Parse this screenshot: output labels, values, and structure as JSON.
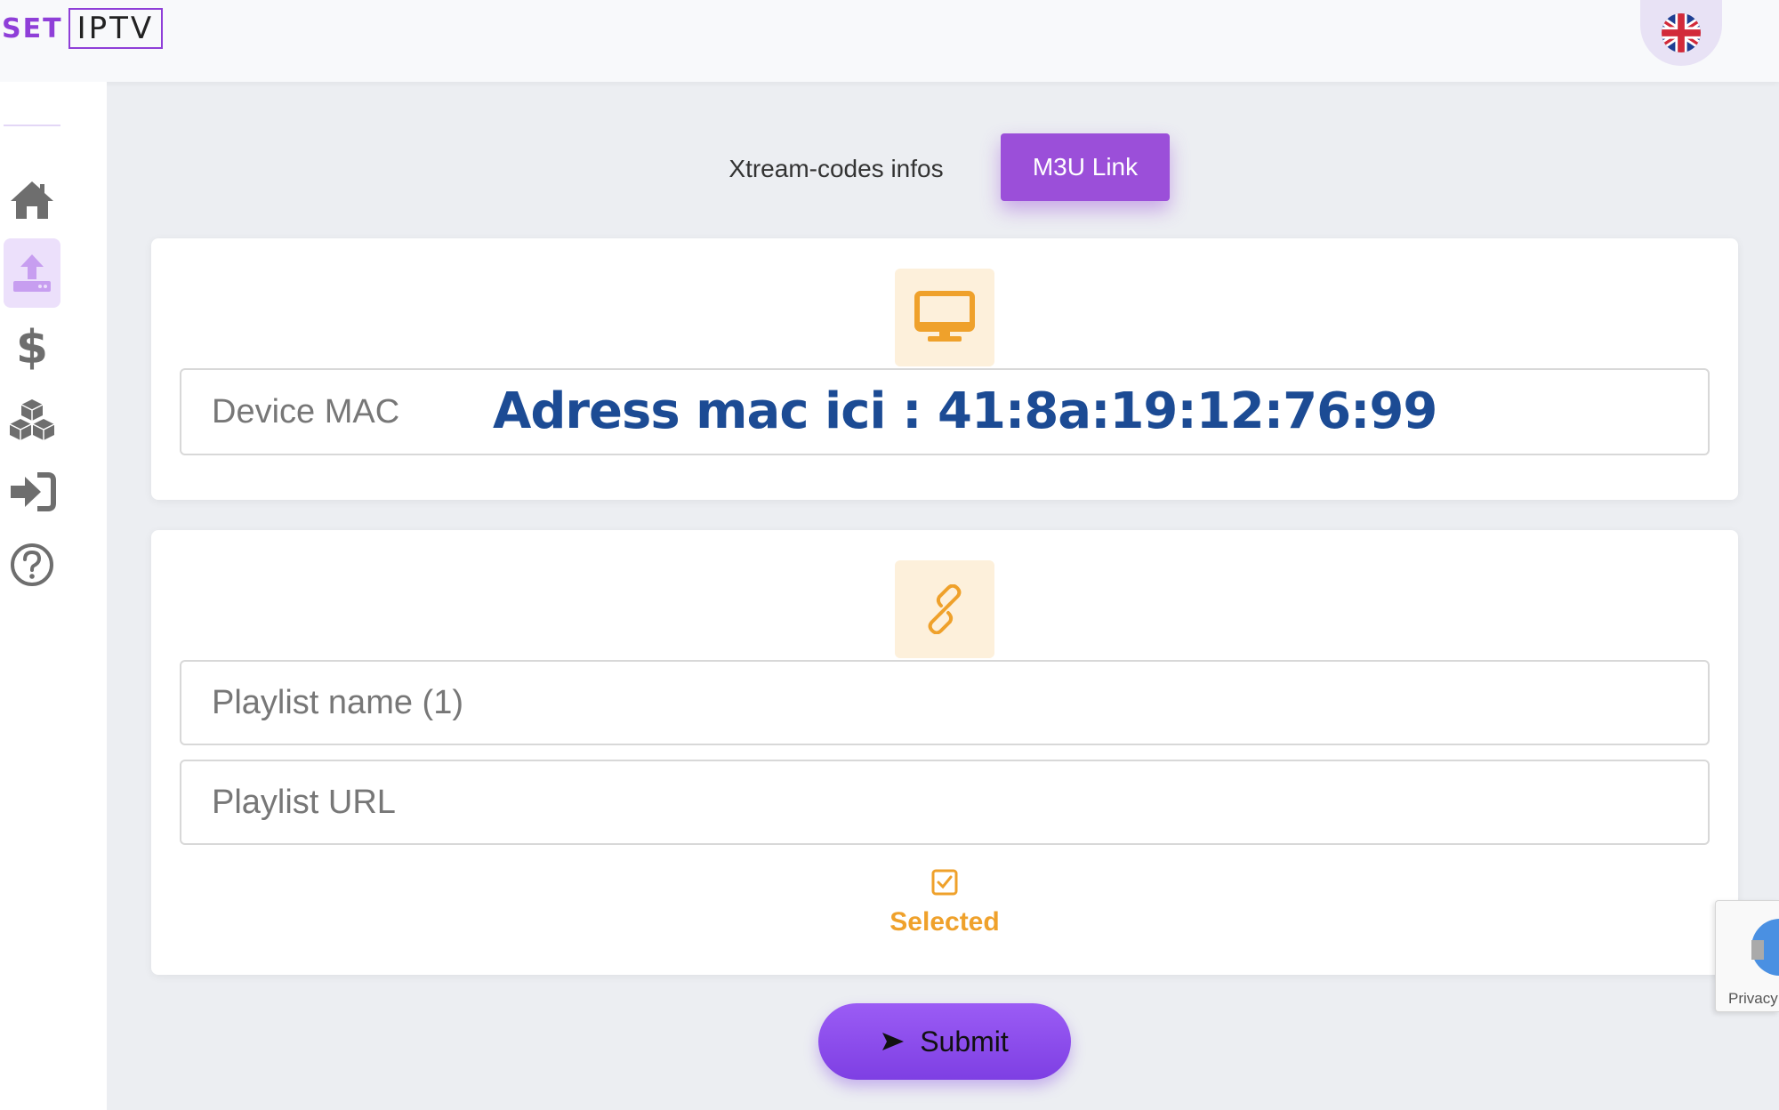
{
  "header": {
    "logo_set": "SET",
    "logo_iptv": "IPTV",
    "language_flag": "uk-flag-icon"
  },
  "sidebar": {
    "items": [
      {
        "icon": "home-icon",
        "active": false
      },
      {
        "icon": "upload-icon",
        "active": true
      },
      {
        "icon": "dollar-icon",
        "active": false
      },
      {
        "icon": "cubes-icon",
        "active": false
      },
      {
        "icon": "sign-in-icon",
        "active": false
      },
      {
        "icon": "help-icon",
        "active": false
      }
    ]
  },
  "tabs": {
    "xtream_label": "Xtream-codes infos",
    "m3u_label": "M3U Link",
    "active": "M3U Link"
  },
  "device_card": {
    "icon": "monitor-icon",
    "mac_placeholder": "Device MAC",
    "mac_overlay": "Adress mac ici : 41:8a:19:12:76:99"
  },
  "playlist_card": {
    "icon": "link-icon",
    "name_placeholder": "Playlist name (1)",
    "url_placeholder": "Playlist URL",
    "checkbox_icon": "checkbox-icon",
    "selected_label": "Selected"
  },
  "submit": {
    "label": "Submit",
    "icon": "send-icon"
  },
  "recaptcha": {
    "privacy_label": "Privacy"
  },
  "colors": {
    "accent": "#9b4fd9",
    "submit": "#8a4af0",
    "icon_yellow": "#efa12b",
    "mac_text": "#1c4b94",
    "sidebar_icon": "#6e6e6e"
  }
}
